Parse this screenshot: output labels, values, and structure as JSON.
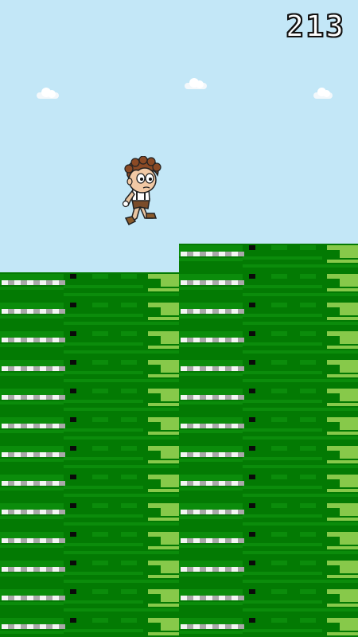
{
  "hud": {
    "score": "213"
  },
  "colors": {
    "sky": "#c3e7f7",
    "grass_dark": "#037a03",
    "grass_mid": "#0b8c0b",
    "grass_light": "#87c94a",
    "stripe_white": "#f4f4f4",
    "stripe_gray": "#a9a9a9",
    "notch": "#0a0a0a"
  },
  "icons": {
    "player": "curly-haired-boy-sprite",
    "cloud": "cloud-icon"
  }
}
